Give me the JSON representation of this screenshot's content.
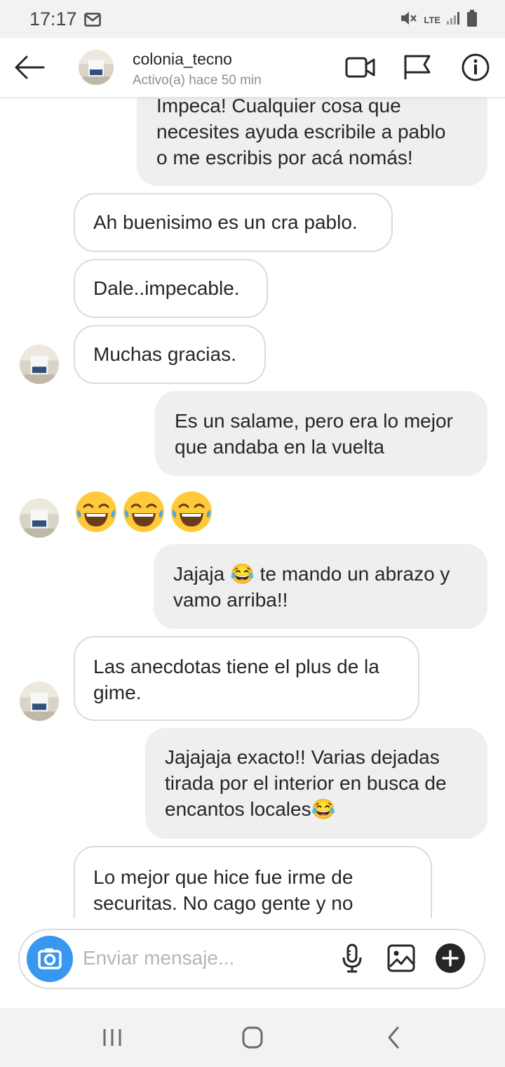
{
  "status_bar": {
    "time": "17:17",
    "network": "LTE"
  },
  "header": {
    "contact_name": "colonia_tecno",
    "contact_status": "Activo(a) hace 50 min"
  },
  "messages": [
    {
      "side": "sent",
      "text": "Impeca! Cualquier cosa que\nnecesites ayuda escribile a pablo\no me escribis por acá nomás!"
    },
    {
      "side": "received",
      "text": "Ah buenisimo es un cra pablo."
    },
    {
      "side": "received",
      "text": "Dale..impecable."
    },
    {
      "side": "received",
      "text": "Muchas gracias."
    },
    {
      "side": "sent",
      "text": "Es un salame, pero era lo mejor\nque andaba en la vuelta"
    },
    {
      "side": "received",
      "text": "😂😂😂"
    },
    {
      "side": "sent",
      "text": "Jajaja 😂 te mando un abrazo y\nvamo arriba!!"
    },
    {
      "side": "received",
      "text": "Las anecdotas tiene el plus de la\ngime."
    },
    {
      "side": "sent",
      "text": "Jajajaja exacto!! Varias dejadas\ntirada por el interior en busca de\nencantos locales😂"
    },
    {
      "side": "received",
      "text": "Lo mejor que hice fue irme de\nsecuritas. No cago gente y no"
    }
  ],
  "composer": {
    "placeholder": "Enviar mensaje..."
  },
  "icons": {
    "back": "back-arrow-icon",
    "video": "video-call-icon",
    "flag": "flag-icon",
    "info": "info-icon",
    "camera": "camera-icon",
    "mic": "microphone-icon",
    "gallery": "gallery-icon",
    "plus": "plus-circle-icon"
  },
  "colors": {
    "accent": "#3897f0",
    "sent_bubble": "#efefef",
    "received_border": "#dbdbdb"
  }
}
